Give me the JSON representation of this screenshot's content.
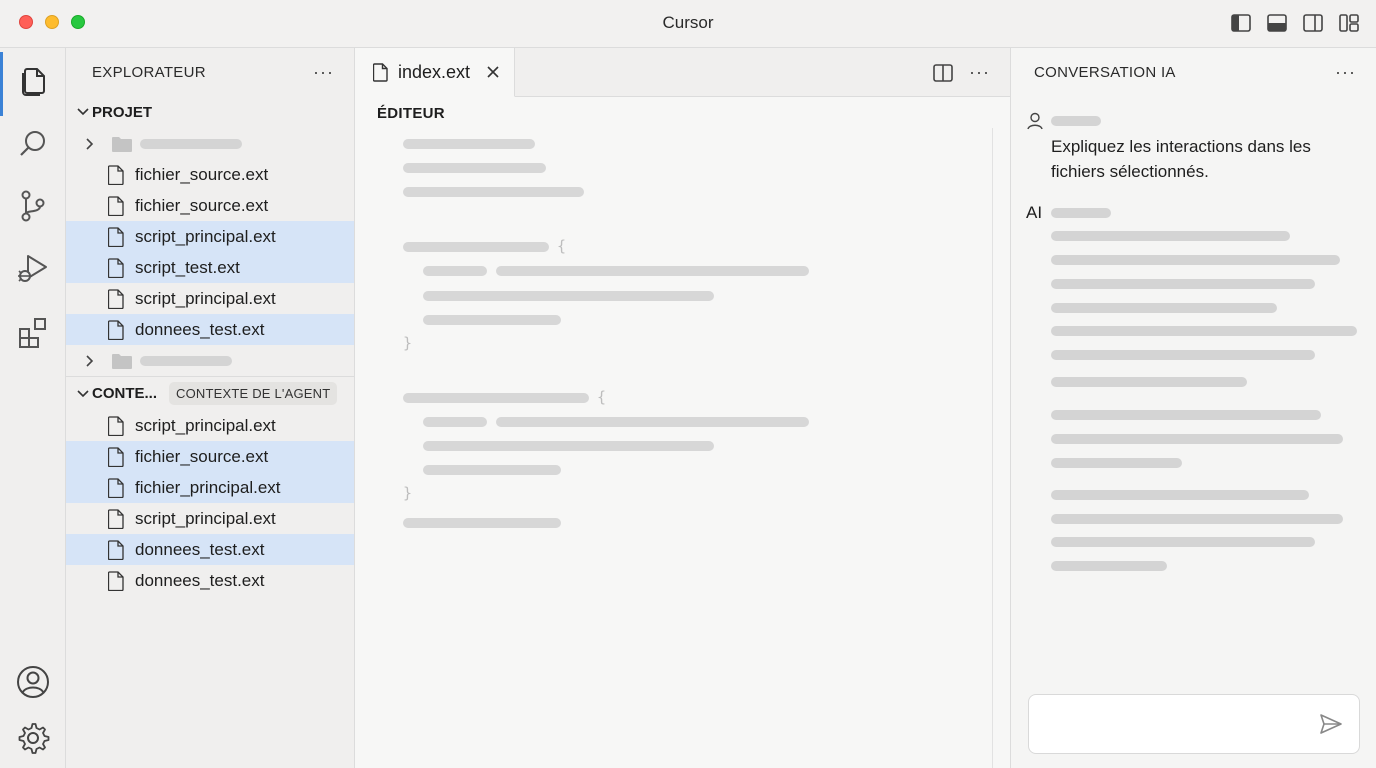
{
  "window": {
    "title": "Cursor"
  },
  "sidebar": {
    "header": "EXPLORATEUR",
    "project": {
      "label": "PROJET",
      "files": [
        {
          "name": "fichier_source.ext",
          "selected": false
        },
        {
          "name": "fichier_source.ext",
          "selected": false
        },
        {
          "name": "script_principal.ext",
          "selected": true
        },
        {
          "name": "script_test.ext",
          "selected": true
        },
        {
          "name": "script_principal.ext",
          "selected": false
        },
        {
          "name": "donnees_test.ext",
          "selected": true
        }
      ]
    },
    "context": {
      "label": "CONTE...",
      "badge": "CONTEXTE DE L'AGENT",
      "files": [
        {
          "name": "script_principal.ext",
          "selected": false
        },
        {
          "name": "fichier_source.ext",
          "selected": true
        },
        {
          "name": "fichier_principal.ext",
          "selected": true
        },
        {
          "name": "script_principal.ext",
          "selected": false
        },
        {
          "name": "donnees_test.ext",
          "selected": true
        },
        {
          "name": "donnees_test.ext",
          "selected": false
        }
      ]
    }
  },
  "editor": {
    "tab": "index.ext",
    "label": "ÉDITEUR"
  },
  "chat": {
    "header": "CONVERSATION IA",
    "user_message": "Expliquez les interactions dans les fichiers sélectionnés.",
    "ai_label": "AI",
    "input_placeholder": ""
  },
  "colors": {
    "selection": "#d6e4f7",
    "accent": "#3b82d6",
    "placeholder": "#d4d4d4"
  }
}
